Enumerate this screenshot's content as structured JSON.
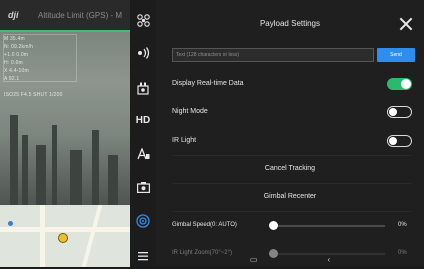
{
  "topbar": {
    "logo": "dji",
    "status": "Altitude Limit (GPS) - M"
  },
  "camera_overlay": {
    "lines": [
      "M 35.4m",
      "N: 09.2km/h",
      "+1.0 0.0m",
      "H: 0.6m",
      "X 4.4-10m",
      "A 92.1",
      "",
      "ISO25  F4.5  SHUT 1/200"
    ]
  },
  "toolbar": {
    "icons": [
      "fan-icon",
      "broadcast-icon",
      "payload-icon",
      "hd-icon",
      "text-icon",
      "camera-icon",
      "target-icon",
      "more-icon"
    ],
    "hd_label": "HD"
  },
  "panel": {
    "title": "Payload Settings",
    "text_input": {
      "placeholder": "Text (128 characters or less)",
      "value": ""
    },
    "send_label": "Send",
    "realtime_label": "Display Real-time Data",
    "realtime_on": true,
    "night_mode_label": "Night Mode",
    "night_mode_on": false,
    "ir_light_label": "IR Light",
    "ir_light_on": false,
    "cancel_tracking_label": "Cancel Tracking",
    "gimbal_recenter_label": "Gimbal Recenter",
    "gimbal_speed_label": "Gimbal Speed(0: AUTO)",
    "gimbal_speed_value": "0%",
    "ir_zoom_label": "IR Light Zoom(70°~2°)",
    "ir_zoom_value": "0%"
  },
  "navbar": {
    "home": "▭",
    "back": "‹"
  },
  "colors": {
    "accent": "#2d8ef0",
    "toggle_on": "#2aba6f"
  }
}
